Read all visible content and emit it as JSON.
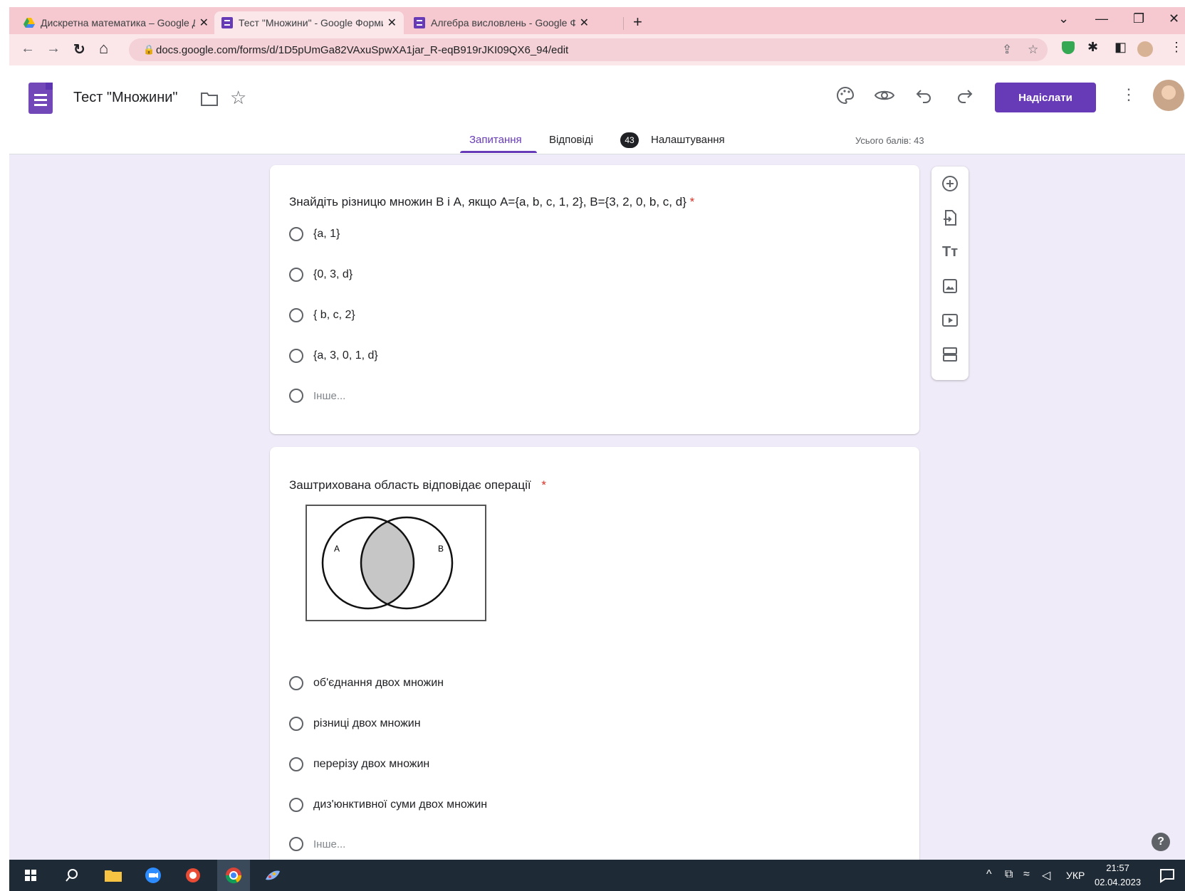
{
  "browser": {
    "tabs": [
      {
        "title": "Дискретна математика – Google Диск",
        "close": "✕"
      },
      {
        "title": "Тест \"Множини\" - Google Форми",
        "close": "✕"
      },
      {
        "title": "Алгебра висловлень - Google Форми",
        "close": "✕"
      }
    ],
    "new_tab": "+",
    "window_controls": [
      "⌄",
      "—",
      "❐",
      "✕"
    ],
    "nav": {
      "back": "←",
      "forward": "→",
      "reload": "↻",
      "home": "⌂"
    },
    "url": "docs.google.com/forms/d/1D5pUmGa82VAxuSpwXA1jar_R-eqB919rJKI09QX6_94/edit"
  },
  "form": {
    "title": "Тест \"Множини\"",
    "send_label": "Надіслати",
    "tabs": {
      "questions": "Запитання",
      "responses": "Відповіді",
      "responses_count": "43",
      "settings": "Налаштування"
    },
    "total_points": "Усього балів: 43"
  },
  "questions": [
    {
      "title": "Знайдіть різницю множин B і A, якщо A={a, b, c, 1, 2}, B={3, 2, 0, b, c, d}",
      "required_mark": "*",
      "options": [
        "{a, 1}",
        "{0, 3, d}",
        "{ b, c, 2}",
        "{a, 3, 0, 1, d}"
      ],
      "other": "Інше..."
    },
    {
      "title": "Заштрихована область відповідає операції",
      "required_mark": "*",
      "image_labels": {
        "a": "A",
        "b": "B"
      },
      "options": [
        "об'єднання двох множин",
        "різниці двох множин",
        "перерізу двох множин",
        "диз'юнктивної суми двох множин"
      ],
      "other": "Інше..."
    }
  ],
  "help": "?",
  "taskbar": {
    "language": "УКР",
    "time": "21:57",
    "date": "02.04.2023"
  },
  "colors": {
    "accent": "#673ab7",
    "background": "#f0ebf8",
    "tab_strip": "#f6c8cf",
    "required": "#d93025"
  }
}
